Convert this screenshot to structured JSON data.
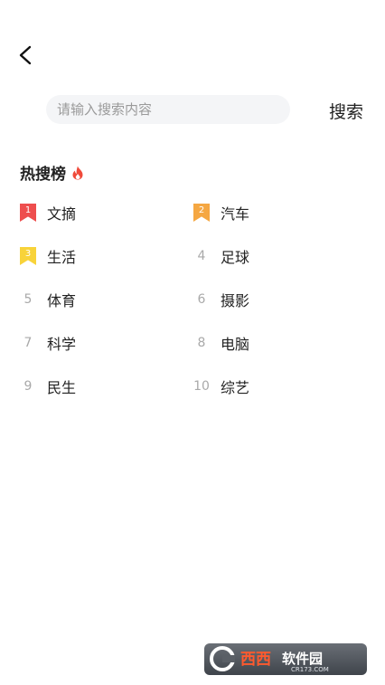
{
  "search": {
    "placeholder": "请输入搜索内容",
    "button_label": "搜索"
  },
  "hot": {
    "title": "热搜榜",
    "items": [
      {
        "rank": "1",
        "label": "文摘"
      },
      {
        "rank": "2",
        "label": "汽车"
      },
      {
        "rank": "3",
        "label": "生活"
      },
      {
        "rank": "4",
        "label": "足球"
      },
      {
        "rank": "5",
        "label": "体育"
      },
      {
        "rank": "6",
        "label": "摄影"
      },
      {
        "rank": "7",
        "label": "科学"
      },
      {
        "rank": "8",
        "label": "电脑"
      },
      {
        "rank": "9",
        "label": "民生"
      },
      {
        "rank": "10",
        "label": "综艺"
      }
    ]
  },
  "colors": {
    "rank1": "#ee4e4e",
    "rank2": "#f5a742",
    "rank3": "#f8d33a",
    "fire": "#f04a3a"
  },
  "watermark": {
    "brand": "西西软件园",
    "site": "CR173.COM"
  }
}
